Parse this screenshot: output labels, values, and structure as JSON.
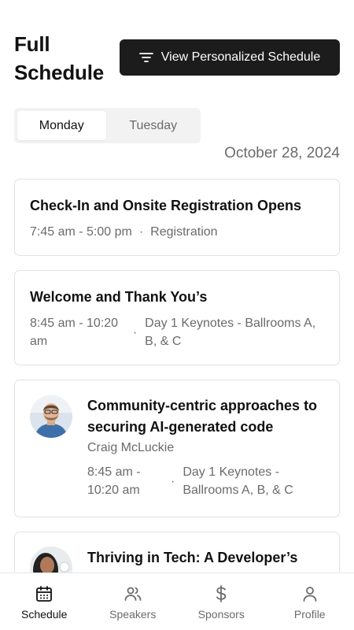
{
  "header": {
    "title_line1": "Full",
    "title_line2": "Schedule",
    "personalized_button": "View Personalized Schedule"
  },
  "day_tabs": [
    "Monday",
    "Tuesday"
  ],
  "selected_day": "Monday",
  "date": "October 28, 2024",
  "sessions": [
    {
      "title": "Check-In and Onsite Registration Opens",
      "time": "7:45 am - 5:00 pm",
      "location": "Registration"
    },
    {
      "title": "Welcome and Thank You’s",
      "time": "8:45 am - 10:20 am",
      "location": "Day 1 Keynotes - Ballrooms A, B, & C"
    },
    {
      "title": "Community-centric approaches to securing AI-generated code",
      "speaker": "Craig McLuckie",
      "time": "8:45 am - 10:20 am",
      "location": "Day 1 Keynotes - Ballrooms A, B, & C"
    },
    {
      "title": "Thriving in Tech: A Developer’s"
    }
  ],
  "bottom_nav": [
    {
      "label": "Schedule",
      "icon": "calendar-icon",
      "active": true
    },
    {
      "label": "Speakers",
      "icon": "users-icon",
      "active": false
    },
    {
      "label": "Sponsors",
      "icon": "dollar-icon",
      "active": false
    },
    {
      "label": "Profile",
      "icon": "user-icon",
      "active": false
    }
  ],
  "colors": {
    "primary_button": "#1c1c1c",
    "text": "#111111",
    "muted": "#6b6b6b",
    "border": "#e2e2e2",
    "tab_bg": "#f2f2f2"
  }
}
